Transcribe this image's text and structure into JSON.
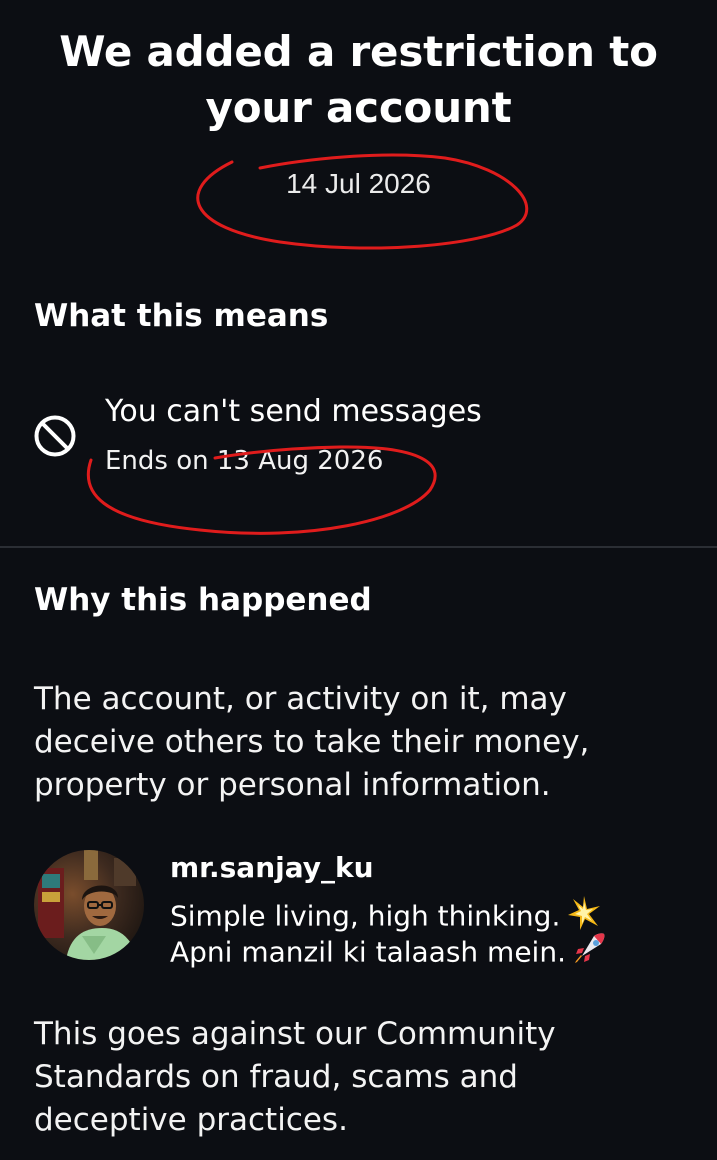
{
  "header": {
    "title": "We added a restriction to your account",
    "date": "14 Jul 2026"
  },
  "what_this_means": {
    "heading": "What this means",
    "restriction": {
      "text": "You can't send messages",
      "ends": "Ends on 13 Aug 2026",
      "icon": "block-icon"
    }
  },
  "why_this_happened": {
    "heading": "Why this happened",
    "reason": "The account, or activity on it, may deceive others to take their money, property or personal information."
  },
  "profile": {
    "username": "mr.sanjay_ku",
    "bio_line1": "Simple living, high thinking.",
    "bio_line2": "Apni manzil ki talaash mein.",
    "bio_icon1": "sparkle-icon",
    "bio_icon2": "rocket-icon"
  },
  "standards": {
    "text": "This goes against our Community Standards on fraud, scams and deceptive practices."
  },
  "annotation": {
    "color": "#e01c1c"
  }
}
